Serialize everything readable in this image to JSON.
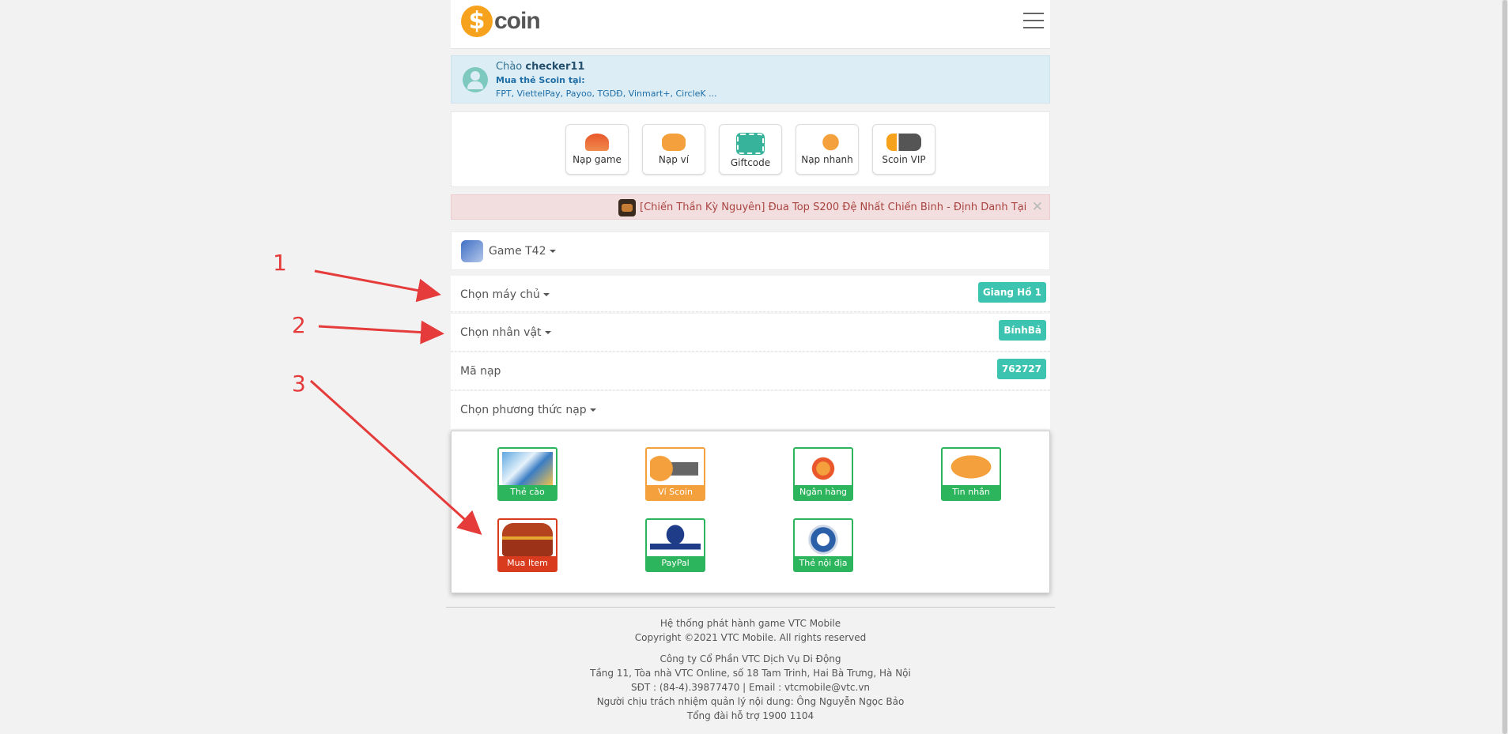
{
  "header": {
    "logo_symbol": "$",
    "logo_text": "coin",
    "menu_icon": "hamburger-icon"
  },
  "greeting": {
    "prefix": "Chào ",
    "username": "checker11",
    "buy_label": "Mua thẻ Scoin tại:",
    "stores": "FPT, ViettelPay, Payoo, TGDĐ, Vinmart+, CircleK ..."
  },
  "quick_actions": [
    {
      "label": "Nạp game",
      "icon": "coin-stack-icon",
      "color": "#e9572b"
    },
    {
      "label": "Nạp ví",
      "icon": "money-bag-icon",
      "color": "#f4a03c"
    },
    {
      "label": "Giftcode",
      "icon": "gift-card-icon",
      "color": "#38b39b"
    },
    {
      "label": "Nạp nhanh",
      "icon": "fast-coin-icon",
      "color": "#f4a03c"
    },
    {
      "label": "Scoin VIP",
      "icon": "scoin-vip-icon",
      "color": "#f6a21c"
    }
  ],
  "notice": {
    "text": "[Chiến Thần Kỳ Nguyên] Đua Top S200 Đệ Nhất Chiến Binh - Định Danh Tại",
    "close": "✕"
  },
  "game": {
    "label": "Game T42"
  },
  "form": {
    "server_label": "Chọn máy chủ",
    "server_value": "Giang Hồ 1",
    "character_label": "Chọn nhân vật",
    "character_value": "BínhBả",
    "code_label": "Mã nạp",
    "code_value": "762727",
    "method_label": "Chọn phương thức nạp"
  },
  "payment_methods": [
    {
      "label": "Thẻ cào",
      "icon": "scratch-card-icon",
      "accent": "#2db55d"
    },
    {
      "label": "Ví Scoin",
      "icon": "scoin-wallet-icon",
      "accent": "#f4a03c"
    },
    {
      "label": "Ngân hàng",
      "icon": "bank-icon",
      "accent": "#2db55d"
    },
    {
      "label": "Tin nhắn",
      "icon": "sms-icon",
      "accent": "#2db55d"
    },
    {
      "label": "Mua Item",
      "icon": "treasure-chest-icon",
      "accent": "#d93b1e"
    },
    {
      "label": "PayPal",
      "icon": "paypal-icon",
      "accent": "#2db55d"
    },
    {
      "label": "Thẻ nội địa",
      "icon": "atm-card-icon",
      "accent": "#2db55d"
    }
  ],
  "footer": {
    "line1": "Hệ thống phát hành game VTC Mobile",
    "line2": "Copyright ©2021 VTC Mobile. All rights reserved",
    "line3": "Công ty Cổ Phần VTC Dịch Vụ Di Động",
    "line4": "Tầng 11, Tòa nhà VTC Online, số 18 Tam Trinh, Hai Bà Trưng, Hà Nội",
    "line5": "SĐT : (84-4).39877470 | Email : vtcmobile@vtc.vn",
    "line6": "Người chịu trách nhiệm quản lý nội dung: Ông Nguyễn Ngọc Bảo",
    "line7": "Tổng đài hỗ trợ 1900 1104"
  },
  "annotations": {
    "n1": "1",
    "n2": "2",
    "n3": "3",
    "color": "#e53b3b"
  }
}
